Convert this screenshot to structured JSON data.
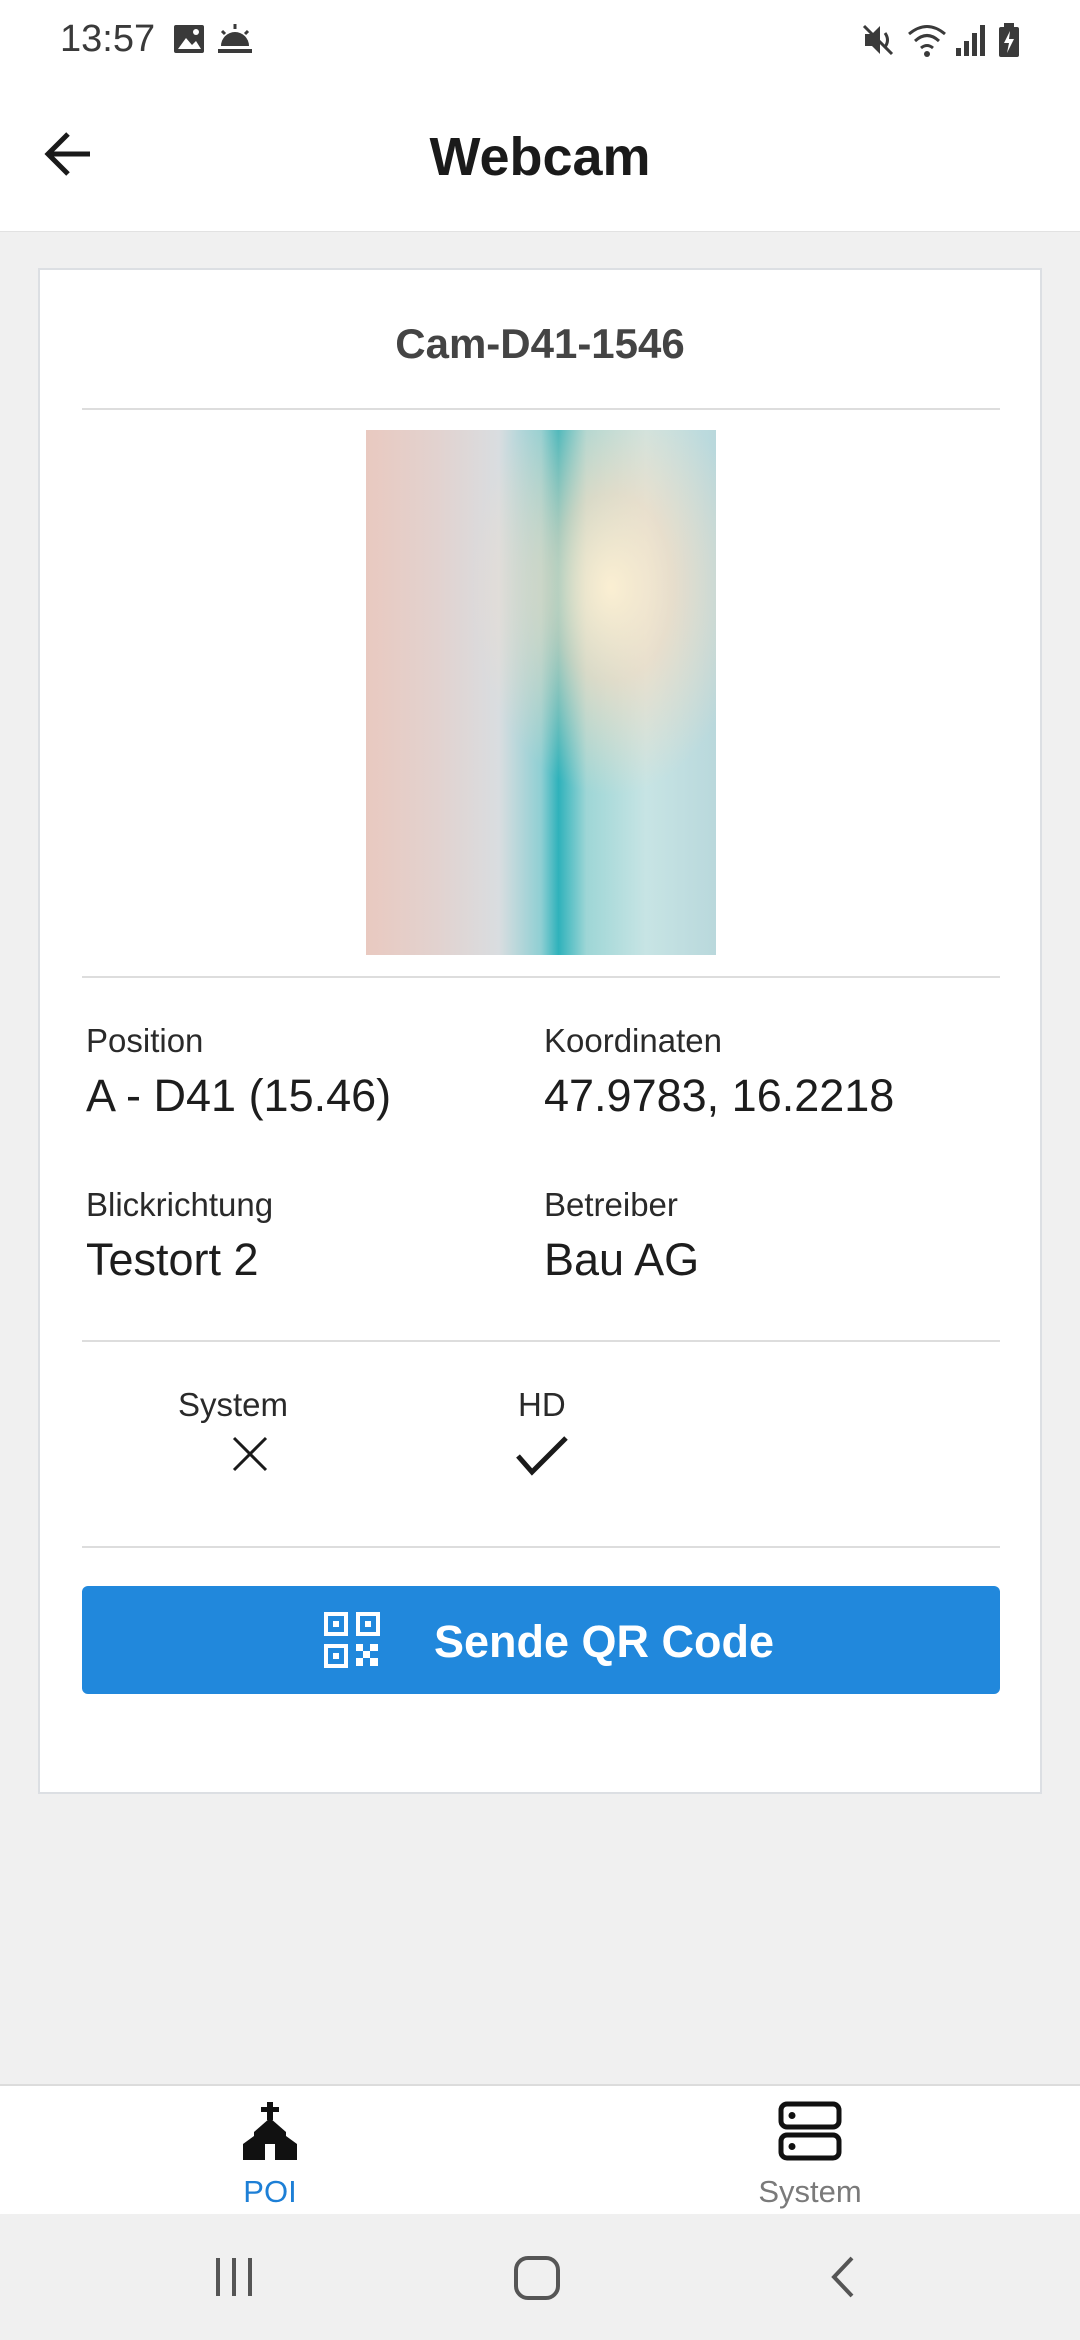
{
  "status_bar": {
    "time": "13:57",
    "left_icons": [
      "image-icon",
      "weather-icon"
    ],
    "right_icons": [
      "mute-icon",
      "wifi-icon",
      "signal-icon",
      "battery-icon"
    ]
  },
  "app_bar": {
    "title": "Webcam",
    "back_icon": "arrow-back-icon"
  },
  "card": {
    "camera_name": "Cam-D41-1546",
    "fields": [
      {
        "label": "Position",
        "value": "A - D41 (15.46)"
      },
      {
        "label": "Koordinaten",
        "value": "47.9783, 16.2218"
      },
      {
        "label": "Blickrichtung",
        "value": "Testort 2"
      },
      {
        "label": "Betreiber",
        "value": "Bau AG"
      }
    ],
    "flags": [
      {
        "label": "System",
        "state": false,
        "icon": "cross-icon"
      },
      {
        "label": "HD",
        "state": true,
        "icon": "check-icon"
      }
    ],
    "qr_button": {
      "label": "Sende QR Code",
      "icon": "qr-code-icon"
    }
  },
  "bottom_nav": {
    "items": [
      {
        "label": "POI",
        "icon": "church-icon",
        "active": true
      },
      {
        "label": "System",
        "icon": "server-icon",
        "active": false
      }
    ]
  },
  "colors": {
    "accent": "#2188dc",
    "nav_active": "#1d7fd6",
    "nav_inactive": "#7a7a7a"
  }
}
